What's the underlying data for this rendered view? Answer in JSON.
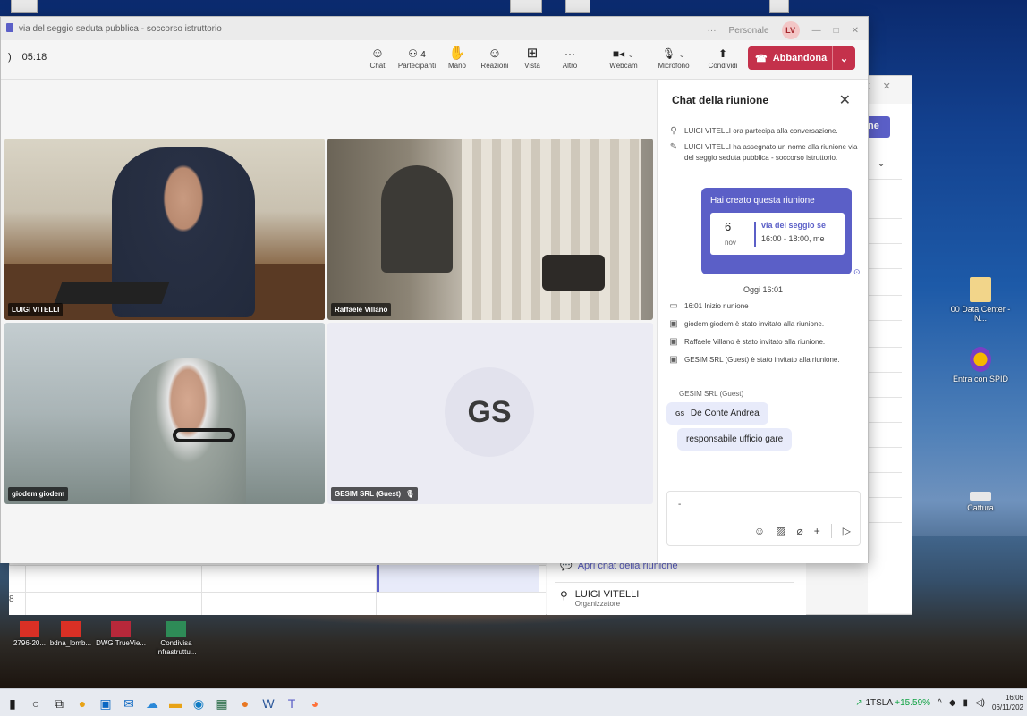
{
  "meeting": {
    "title": "via del seggio seduta pubblica - soccorso istruttorio",
    "account": "Personale",
    "avatar_initials": "LV",
    "timer": "05:18",
    "toolbar": {
      "chat": "Chat",
      "participants": "Partecipanti",
      "participants_count": "4",
      "hand": "Mano",
      "reactions": "Reazioni",
      "view": "Vista",
      "more": "Altro",
      "webcam": "Webcam",
      "mic": "Microfono",
      "share": "Condividi",
      "leave": "Abbandona"
    },
    "tiles": [
      {
        "name": "LUIGI VITELLI"
      },
      {
        "name": "Raffaele Villano"
      },
      {
        "name": "giodem giodem"
      },
      {
        "name": "GESIM SRL (Guest)",
        "initials": "GS"
      }
    ]
  },
  "chat": {
    "title": "Chat della riunione",
    "system_messages": [
      "LUIGI VITELLI ora partecipa alla conversazione.",
      "LUIGI VITELLI ha assegnato un nome alla riunione via del seggio seduta pubblica - soccorso istruttorio."
    ],
    "card": {
      "header": "Hai creato questa riunione",
      "day": "6",
      "month": "nov",
      "event": "via del seggio se",
      "time": "16:00 - 18:00, me"
    },
    "today_label": "Oggi 16:01",
    "events": [
      "16:01  Inizio riunione",
      "giodem giodem è stato invitato alla riunione.",
      "Raffaele Villano è stato invitato alla riunione.",
      "GESIM SRL (Guest) è stato invitato alla riunione."
    ],
    "sender": "GESIM SRL (Guest)",
    "sender_initials": "GS",
    "messages": [
      "De Conte Andrea",
      "responsabile ufficio gare"
    ],
    "compose_value": "-"
  },
  "background_window": {
    "button_partial": "ne",
    "open_chat": "Apri chat della riunione",
    "organizer_name": "LUIGI VITELLI",
    "organizer_role": "Organizzatore",
    "row_number": "8"
  },
  "desktop_icons": [
    {
      "label": "00 Data Center - N..."
    },
    {
      "label": "Entra con SPID"
    },
    {
      "label": "Cattura"
    }
  ],
  "bottom_icons": [
    {
      "label": "2796-20..."
    },
    {
      "label": "bdna_lomb..."
    },
    {
      "label": "DWG TrueVie..."
    },
    {
      "label": "Condivisa Infrastruttu..."
    }
  ],
  "taskbar": {
    "stock": "1TSLA",
    "stock_change": "+15.59%",
    "time": "16:06",
    "date": "06/11/202"
  }
}
